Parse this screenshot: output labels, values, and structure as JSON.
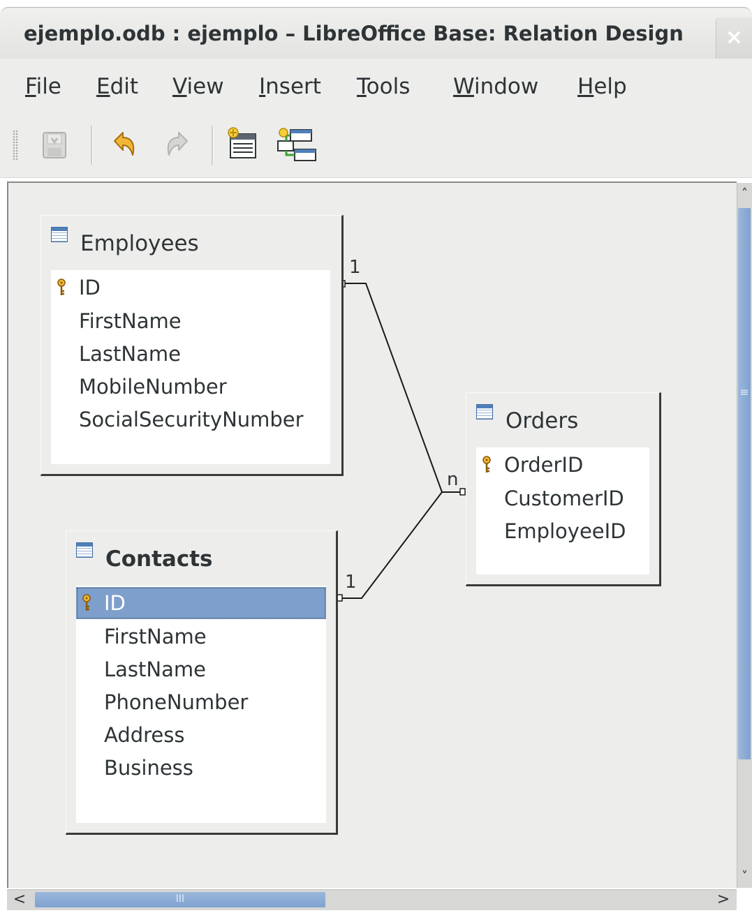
{
  "window": {
    "title": "ejemplo.odb : ejemplo – LibreOffice Base: Relation Design",
    "close_glyph": "×"
  },
  "menu": [
    {
      "mnemonic": "F",
      "rest": "ile"
    },
    {
      "mnemonic": "E",
      "rest": "dit"
    },
    {
      "mnemonic": "V",
      "rest": "iew"
    },
    {
      "mnemonic": "I",
      "rest": "nsert"
    },
    {
      "mnemonic": "T",
      "rest": "ools"
    },
    {
      "mnemonic": "W",
      "rest": "indow"
    },
    {
      "mnemonic": "H",
      "rest": "elp"
    }
  ],
  "toolbar": {
    "icons": [
      "save-icon",
      "undo-icon",
      "redo-icon",
      "add-tables-icon",
      "new-relation-icon"
    ]
  },
  "tables": {
    "employees": {
      "name": "Employees",
      "fields": [
        "ID",
        "FirstName",
        "LastName",
        "MobileNumber",
        "SocialSecurityNumber"
      ],
      "primary_key": "ID"
    },
    "orders": {
      "name": "Orders",
      "fields": [
        "OrderID",
        "CustomerID",
        "EmployeeID"
      ],
      "primary_key": "OrderID"
    },
    "contacts": {
      "name": "Contacts",
      "fields": [
        "ID",
        "FirstName",
        "LastName",
        "PhoneNumber",
        "Address",
        "Business"
      ],
      "primary_key": "ID",
      "selected_field": "ID"
    }
  },
  "relations": {
    "employees_side": "1",
    "contacts_side": "1",
    "orders_side": "n"
  },
  "scroll": {
    "v_grip": "≡",
    "h_grip": "III",
    "up": "˄",
    "down": "˅",
    "left": "<",
    "right": ">"
  },
  "colors": {
    "selection": "#7e9fcb",
    "key_icon": "#e8a317",
    "table_icon": "#4f7fb9"
  }
}
